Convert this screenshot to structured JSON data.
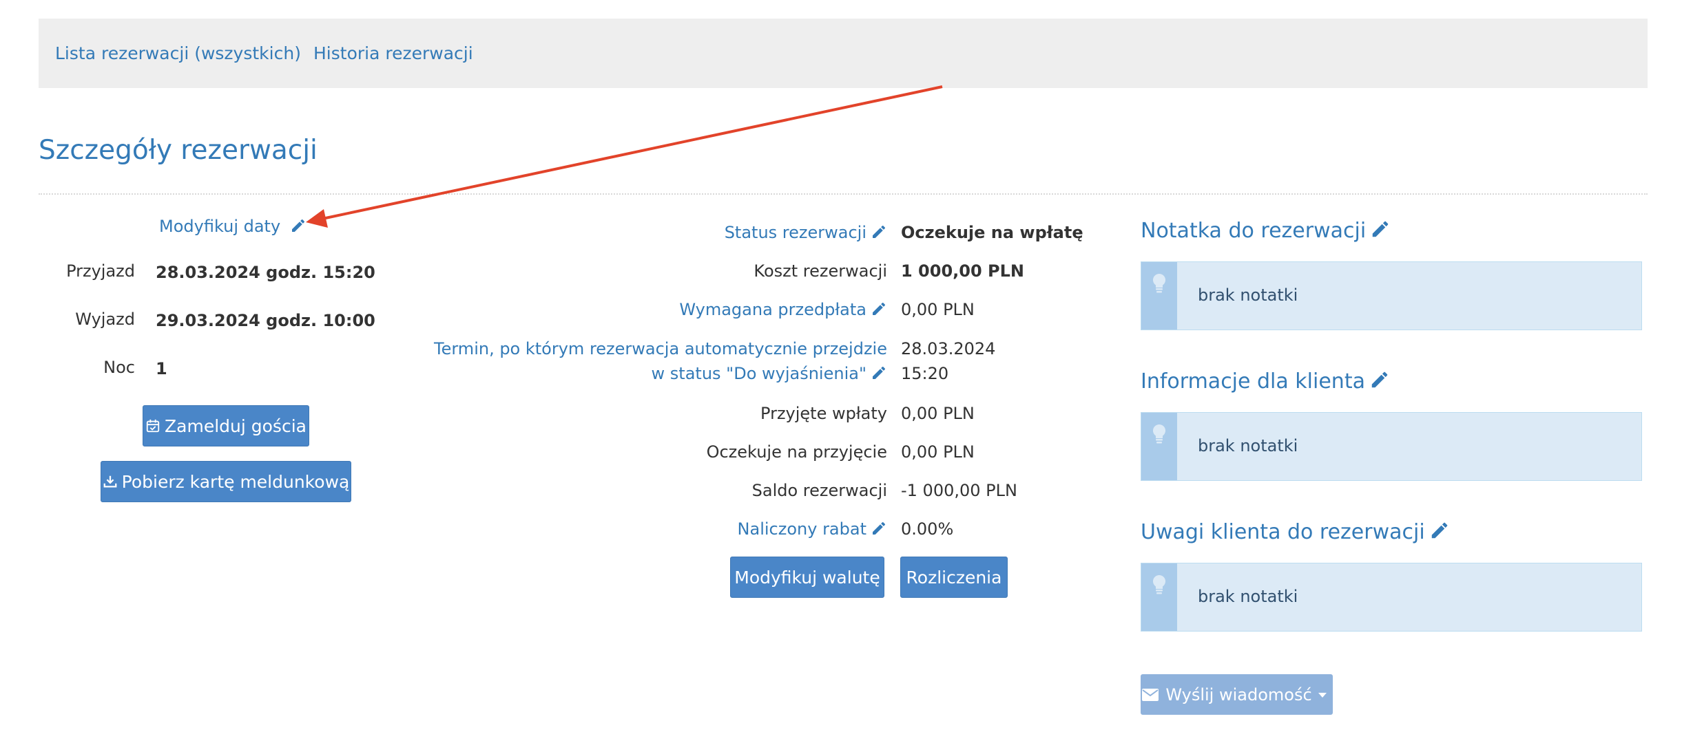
{
  "nav": {
    "items": [
      {
        "label": "Lista rezerwacji (wszystkich)"
      },
      {
        "label": "Historia rezerwacji"
      }
    ]
  },
  "page": {
    "title": "Szczegóły rezerwacji"
  },
  "dates": {
    "modify_label": "Modyfikuj daty",
    "arrival_label": "Przyjazd",
    "arrival_value": "28.03.2024 godz. 15:20",
    "departure_label": "Wyjazd",
    "departure_value": "29.03.2024 godz. 10:00",
    "nights_label": "Noc",
    "nights_value": "1",
    "checkin_button": "Zamelduj gościa",
    "download_button": "Pobierz kartę meldunkową"
  },
  "details": {
    "status_label": "Status rezerwacji",
    "status_value": "Oczekuje na wpłatę",
    "cost_label": "Koszt rezerwacji",
    "cost_value": "1 000,00 PLN",
    "prepayment_label": "Wymagana przedpłata",
    "prepayment_value": "0,00 PLN",
    "deadline_label_line1": "Termin, po którym rezerwacja automatycznie przejdzie",
    "deadline_label_line2": "w status \"Do wyjaśnienia\"",
    "deadline_date": "28.03.2024",
    "deadline_time": "15:20",
    "received_label": "Przyjęte wpłaty",
    "received_value": "0,00 PLN",
    "pending_label": "Oczekuje na przyjęcie",
    "pending_value": "0,00 PLN",
    "balance_label": "Saldo rezerwacji",
    "balance_value": "-1 000,00 PLN",
    "discount_label": "Naliczony rabat",
    "discount_value": "0.00%",
    "currency_button": "Modyfikuj walutę",
    "settlements_button": "Rozliczenia"
  },
  "notes": {
    "reservation_note_title": "Notatka do rezerwacji",
    "reservation_note_text": "brak notatki",
    "client_info_title": "Informacje dla klienta",
    "client_info_text": "brak notatki",
    "client_remarks_title": "Uwagi klienta do rezerwacji",
    "client_remarks_text": "brak notatki",
    "send_message_button": "Wyślij wiadomość"
  },
  "colors": {
    "link": "#337ab7",
    "button": "#4a86c8",
    "button_disabled": "#8fb2dc",
    "note_bg": "#dceaf6",
    "annotation_arrow": "#e2432a"
  },
  "icons": {
    "edit": "pencil-icon",
    "checkin": "calendar-check-icon",
    "download": "download-icon",
    "note": "lightbulb-icon",
    "message": "envelope-icon",
    "dropdown": "caret-down-icon"
  }
}
